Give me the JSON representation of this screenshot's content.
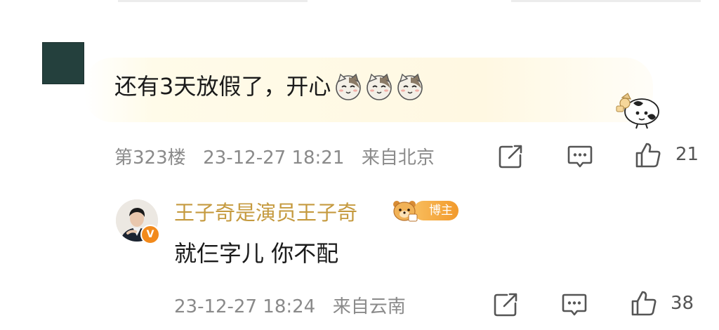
{
  "comment": {
    "floor": "第323楼",
    "text": "还有3天放假了，开心",
    "emojis": [
      "cat-face-icon",
      "cat-face-icon",
      "cat-face-icon"
    ],
    "time": "23-12-27 18:21",
    "location": "来自北京",
    "likes": "21"
  },
  "reply": {
    "user_name": "王子奇是演员王子奇",
    "badge_label": "博主",
    "verified_mark": "V",
    "text": "就仨字儿 你不配",
    "time": "23-12-27 18:24",
    "location": "来自云南",
    "likes": "38"
  },
  "colors": {
    "meta_text": "#8a8a8a",
    "username": "#c59a3f",
    "badge": "#f29a2c",
    "avatar_main": "#24403d"
  }
}
